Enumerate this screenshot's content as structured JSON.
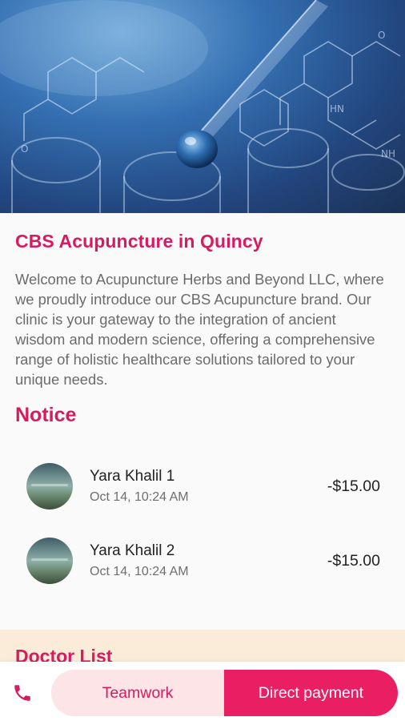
{
  "clinic": {
    "title": "CBS Acupuncture in Quincy",
    "description": "Welcome to Acupuncture Herbs and Beyond LLC, where we proudly introduce our CBS Acupuncture brand. Our clinic is your gateway to the integration of ancient wisdom and modern science, offering a comprehensive range of holistic healthcare solutions tailored to your unique needs."
  },
  "notice": {
    "heading": "Notice",
    "items": [
      {
        "name": "Yara Khalil 1",
        "date": "Oct 14, 10:24 AM",
        "amount": "-$15.00"
      },
      {
        "name": "Yara Khalil 2",
        "date": "Oct 14, 10:24 AM",
        "amount": "-$15.00"
      }
    ]
  },
  "doctor_list": {
    "heading": "Doctor List"
  },
  "bottom_bar": {
    "phone_icon": "phone-icon",
    "teamwork_label": "Teamwork",
    "direct_payment_label": "Direct payment"
  },
  "colors": {
    "accent": "#d81b60",
    "primary_button": "#e91e63",
    "secondary_button": "#fde4e6"
  }
}
